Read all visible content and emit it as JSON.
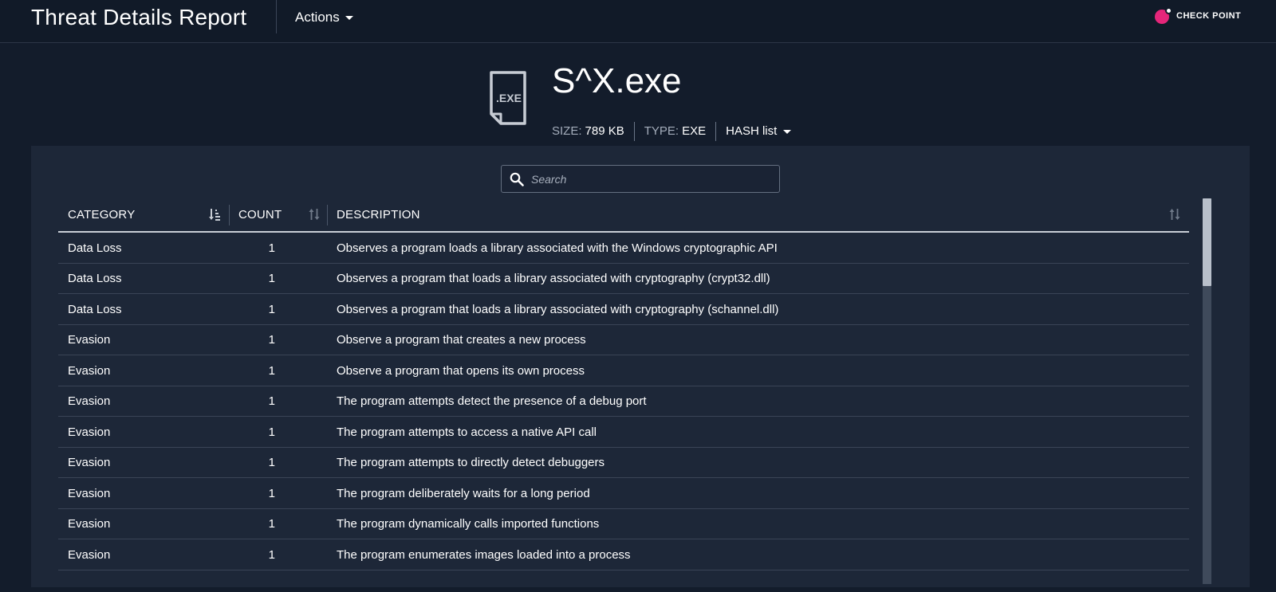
{
  "topbar": {
    "title": "Threat Details Report",
    "actions_label": "Actions",
    "logo_text": "CHECK POINT"
  },
  "file": {
    "icon_label": ".EXE",
    "name": "S^X.exe",
    "size_label": "SIZE:",
    "size_value": "789 KB",
    "type_label": "TYPE:",
    "type_value": "EXE",
    "hash_label": "HASH list"
  },
  "search": {
    "placeholder": "Search",
    "value": ""
  },
  "table": {
    "columns": [
      "CATEGORY",
      "COUNT",
      "DESCRIPTION"
    ],
    "rows": [
      {
        "category": "Data Loss",
        "count": "1",
        "description": "Observes a program loads a library associated with the Windows cryptographic API"
      },
      {
        "category": "Data Loss",
        "count": "1",
        "description": "Observes a program that loads a library associated with cryptography (crypt32.dll)"
      },
      {
        "category": "Data Loss",
        "count": "1",
        "description": "Observes a program that loads a library associated with cryptography (schannel.dll)"
      },
      {
        "category": "Evasion",
        "count": "1",
        "description": "Observe a program that creates a new process"
      },
      {
        "category": "Evasion",
        "count": "1",
        "description": "Observe a program that opens its own process"
      },
      {
        "category": "Evasion",
        "count": "1",
        "description": "The program attempts detect the presence of a debug port"
      },
      {
        "category": "Evasion",
        "count": "1",
        "description": "The program attempts to access a native API call"
      },
      {
        "category": "Evasion",
        "count": "1",
        "description": "The program attempts to directly detect debuggers"
      },
      {
        "category": "Evasion",
        "count": "1",
        "description": "The program deliberately waits for a long period"
      },
      {
        "category": "Evasion",
        "count": "1",
        "description": "The program dynamically calls imported functions"
      },
      {
        "category": "Evasion",
        "count": "1",
        "description": "The program enumerates images loaded into a process"
      }
    ]
  },
  "icons": {
    "search": "search-icon",
    "sort_active": "sort-ascending-icon",
    "sort_inactive": "sort-icon",
    "file": "exe-file-icon",
    "caret": "caret-down-icon"
  },
  "colors": {
    "background": "#131c2b",
    "panel": "#1d2738",
    "brand": "#e5267a"
  }
}
